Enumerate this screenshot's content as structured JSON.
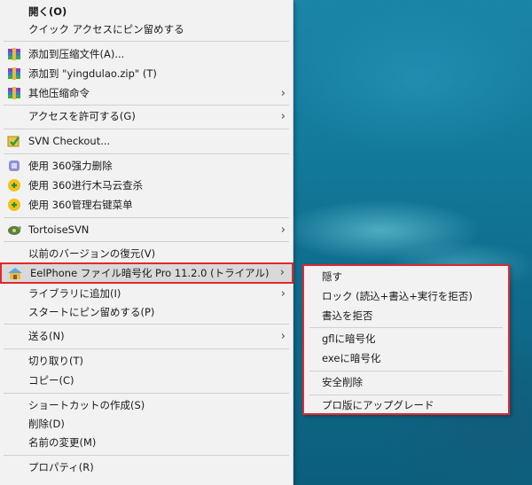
{
  "context_menu": {
    "items": [
      {
        "label": "開く(O)"
      },
      {
        "label": "クイック アクセスにピン留めする"
      },
      {
        "label": "添加到压缩文件(A)...",
        "icon": "winrar-archive-icon"
      },
      {
        "label": "添加到 \"yingdulao.zip\" (T)",
        "icon": "winrar-archive-icon"
      },
      {
        "label": "其他压缩命令",
        "icon": "winrar-archive-icon"
      },
      {
        "label": "アクセスを許可する(G)"
      },
      {
        "label": "SVN Checkout...",
        "icon": "svn-checkout-icon"
      },
      {
        "label": "使用 360强力删除",
        "icon": "360-delete-icon"
      },
      {
        "label": "使用 360进行木马云查杀",
        "icon": "360-scan-icon"
      },
      {
        "label": "使用 360管理右键菜单",
        "icon": "360-manage-icon"
      },
      {
        "label": "TortoiseSVN",
        "icon": "tortoisesvn-icon"
      },
      {
        "label": "以前のバージョンの復元(V)"
      },
      {
        "label": "EelPhone ファイル暗号化 Pro 11.2.0 (トライアル)",
        "icon": "eelphone-icon"
      },
      {
        "label": "ライブラリに追加(I)"
      },
      {
        "label": "スタートにピン留めする(P)"
      },
      {
        "label": "送る(N)"
      },
      {
        "label": "切り取り(T)"
      },
      {
        "label": "コピー(C)"
      },
      {
        "label": "ショートカットの作成(S)"
      },
      {
        "label": "削除(D)"
      },
      {
        "label": "名前の変更(M)"
      },
      {
        "label": "プロパティ(R)"
      }
    ],
    "submenu_arrow": "›"
  },
  "submenu": {
    "items": [
      {
        "label": "隠す"
      },
      {
        "label": "ロック (読込+書込+実行を拒否)"
      },
      {
        "label": "書込を拒否"
      },
      {
        "label": "gflに暗号化"
      },
      {
        "label": "exeに暗号化"
      },
      {
        "label": "安全削除"
      },
      {
        "label": "プロ版にアップグレード"
      }
    ]
  },
  "colors": {
    "highlight_border": "#e3282b",
    "menu_bg": "#f2f2f2",
    "desktop_bg": "#0f6c8d"
  }
}
